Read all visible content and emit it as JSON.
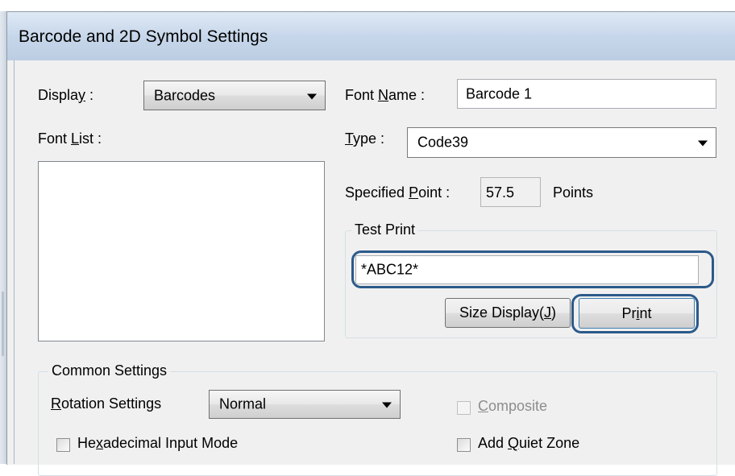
{
  "window": {
    "title": "Barcode and 2D Symbol Settings"
  },
  "display": {
    "label_pre": "Displa",
    "label_u": "y",
    "label_post": " :",
    "value": "Barcodes"
  },
  "font_list": {
    "label_pre": "Font ",
    "label_u": "L",
    "label_post": "ist :"
  },
  "font_name": {
    "label_pre": "Font ",
    "label_u": "N",
    "label_post": "ame :",
    "value": "Barcode 1"
  },
  "type": {
    "label_u": "T",
    "label_post": "ype :",
    "value": "Code39"
  },
  "specified_point": {
    "label_pre": "Specified ",
    "label_u": "P",
    "label_post": "oint :",
    "value": "57.5",
    "unit": "Points"
  },
  "test_print": {
    "group_title": "Test Print",
    "value": "*ABC12*",
    "size_display_pre": "Size Display(",
    "size_display_u": "J",
    "size_display_post": ")",
    "print_pre": "Pr",
    "print_u": "i",
    "print_post": "nt"
  },
  "common_settings": {
    "group_title": "Common Settings",
    "rotation_label_u": "R",
    "rotation_label_post": "otation Settings",
    "rotation_value": "Normal",
    "composite_u": "C",
    "composite_post": "omposite",
    "composite_checked": false,
    "composite_enabled": false,
    "hex_pre": "He",
    "hex_u": "x",
    "hex_post": "adecimal Input Mode",
    "hex_checked": false,
    "quiet_pre": "Add ",
    "quiet_u": "Q",
    "quiet_post": "uiet Zone",
    "quiet_checked": false
  },
  "colors": {
    "highlight": "#2b5a8a",
    "title_bar": "#c7d7ea",
    "dialog_bg": "#f0f0f0"
  }
}
